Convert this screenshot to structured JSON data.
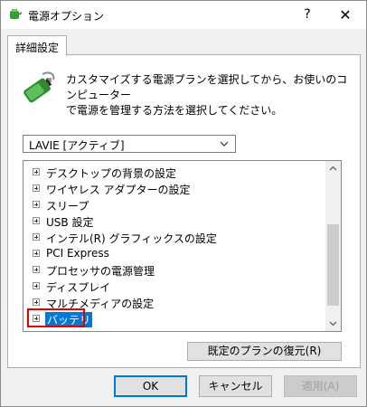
{
  "window": {
    "title": "電源オプション",
    "help_label": "?",
    "close_label": "✕"
  },
  "tab": {
    "label": "詳細設定"
  },
  "description": "カスタマイズする電源プランを選択してから、お使いのコンピューター\nで電源を管理する方法を選択してください。",
  "plan_select": {
    "value": "LAVIE [アクティブ]"
  },
  "tree": {
    "items": [
      {
        "label": "デスクトップの背景の設定"
      },
      {
        "label": "ワイヤレス アダプターの設定"
      },
      {
        "label": "スリープ"
      },
      {
        "label": "USB 設定"
      },
      {
        "label": "インテル(R) グラフィックスの設定"
      },
      {
        "label": "PCI Express"
      },
      {
        "label": "プロセッサの電源管理"
      },
      {
        "label": "ディスプレイ"
      },
      {
        "label": "マルチメディアの設定"
      },
      {
        "label": "バッテリ"
      }
    ]
  },
  "buttons": {
    "restore": "既定のプランの復元(R)",
    "ok": "OK",
    "cancel": "キャンセル",
    "apply": "適用(A)"
  },
  "colors": {
    "selection": "#0078d7",
    "highlight_border": "#e00000"
  }
}
